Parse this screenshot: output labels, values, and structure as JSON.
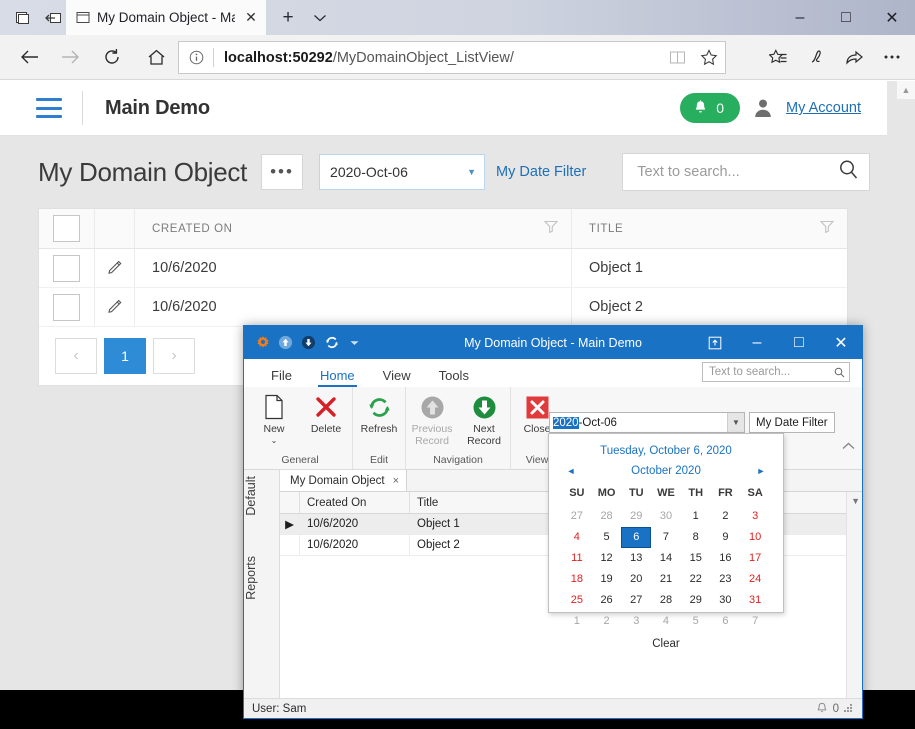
{
  "browser": {
    "tab": {
      "title": "My Domain Object - Ma",
      "close_label": "✕"
    },
    "new_tab_label": "+",
    "tab_menu_label": "⌄",
    "window_controls": {
      "minimize": "–",
      "maximize": "□",
      "close": "✕"
    },
    "address": {
      "protocol_prefix": "localhost:50292",
      "path": "/MyDomainObject_ListView/"
    },
    "nav": {
      "back": "←",
      "forward": "→",
      "refresh": "↻",
      "home": "⌂"
    }
  },
  "webapp": {
    "header": {
      "title": "Main Demo",
      "notification_count": "0",
      "account_link": "My Account"
    },
    "toolbar": {
      "page_title": "My Domain Object",
      "ellipsis_label": "•••",
      "date_value": "2020-Oct-06",
      "date_filter_label": "My Date Filter",
      "search_placeholder": "Text to search..."
    },
    "grid": {
      "columns": [
        "CREATED ON",
        "TITLE"
      ],
      "rows": [
        {
          "created_on": "10/6/2020",
          "title": "Object 1"
        },
        {
          "created_on": "10/6/2020",
          "title": "Object 2"
        }
      ]
    },
    "pager": {
      "prev": "‹",
      "current": "1",
      "next": "›"
    }
  },
  "winform": {
    "title": "My Domain Object - Main Demo",
    "window_controls": {
      "restore_ribbon": "⬒",
      "minimize": "–",
      "maximize": "□",
      "close": "✕"
    },
    "quick_access": [
      "app-gear-icon",
      "up-arrow-icon",
      "down-arrow-icon",
      "refresh-icon",
      "qat-dropdown-icon"
    ],
    "ribbon_tabs": [
      {
        "label": "File",
        "active": false
      },
      {
        "label": "Home",
        "active": true
      },
      {
        "label": "View",
        "active": false
      },
      {
        "label": "Tools",
        "active": false
      }
    ],
    "ribbon_search_placeholder": "Text to search...",
    "ribbon_groups": [
      {
        "name": "General",
        "items": [
          {
            "label": "New",
            "icon": "new-document-icon",
            "disabled": false,
            "has_dropdown": true
          },
          {
            "label": "Delete",
            "icon": "delete-x-icon",
            "disabled": false,
            "has_dropdown": false
          }
        ]
      },
      {
        "name": "Edit",
        "items": [
          {
            "label": "Refresh",
            "icon": "refresh-icon",
            "disabled": false,
            "has_dropdown": false
          }
        ]
      },
      {
        "name": "Navigation",
        "items": [
          {
            "label": "Previous Record",
            "icon": "previous-record-icon",
            "disabled": true,
            "has_dropdown": false
          },
          {
            "label": "Next Record",
            "icon": "next-record-icon",
            "disabled": false,
            "has_dropdown": false
          }
        ]
      },
      {
        "name": "View",
        "items": [
          {
            "label": "Close",
            "icon": "close-x-icon",
            "disabled": false,
            "has_dropdown": false
          }
        ]
      }
    ],
    "date_editor": {
      "selected_part": "2020",
      "rest": "-Oct-06",
      "filter_label": "My Date Filter"
    },
    "calendar": {
      "today_text": "Tuesday, October 6, 2020",
      "month_label": "October 2020",
      "prev_arrow": "◄",
      "next_arrow": "►",
      "dow": [
        "SU",
        "MO",
        "TU",
        "WE",
        "TH",
        "FR",
        "SA"
      ],
      "weeks": [
        [
          {
            "d": "27",
            "t": "off"
          },
          {
            "d": "28",
            "t": "off"
          },
          {
            "d": "29",
            "t": "off"
          },
          {
            "d": "30",
            "t": "off"
          },
          {
            "d": "1",
            "t": "day"
          },
          {
            "d": "2",
            "t": "day"
          },
          {
            "d": "3",
            "t": "we"
          }
        ],
        [
          {
            "d": "4",
            "t": "we"
          },
          {
            "d": "5",
            "t": "day"
          },
          {
            "d": "6",
            "t": "sel"
          },
          {
            "d": "7",
            "t": "day"
          },
          {
            "d": "8",
            "t": "day"
          },
          {
            "d": "9",
            "t": "day"
          },
          {
            "d": "10",
            "t": "we"
          }
        ],
        [
          {
            "d": "11",
            "t": "we"
          },
          {
            "d": "12",
            "t": "day"
          },
          {
            "d": "13",
            "t": "day"
          },
          {
            "d": "14",
            "t": "day"
          },
          {
            "d": "15",
            "t": "day"
          },
          {
            "d": "16",
            "t": "day"
          },
          {
            "d": "17",
            "t": "we"
          }
        ],
        [
          {
            "d": "18",
            "t": "we"
          },
          {
            "d": "19",
            "t": "day"
          },
          {
            "d": "20",
            "t": "day"
          },
          {
            "d": "21",
            "t": "day"
          },
          {
            "d": "22",
            "t": "day"
          },
          {
            "d": "23",
            "t": "day"
          },
          {
            "d": "24",
            "t": "we"
          }
        ],
        [
          {
            "d": "25",
            "t": "we"
          },
          {
            "d": "26",
            "t": "day"
          },
          {
            "d": "27",
            "t": "day"
          },
          {
            "d": "28",
            "t": "day"
          },
          {
            "d": "29",
            "t": "day"
          },
          {
            "d": "30",
            "t": "day"
          },
          {
            "d": "31",
            "t": "we"
          }
        ],
        [
          {
            "d": "1",
            "t": "off"
          },
          {
            "d": "2",
            "t": "off"
          },
          {
            "d": "3",
            "t": "off"
          },
          {
            "d": "4",
            "t": "off"
          },
          {
            "d": "5",
            "t": "off"
          },
          {
            "d": "6",
            "t": "off"
          },
          {
            "d": "7",
            "t": "off"
          }
        ]
      ],
      "clear_label": "Clear"
    },
    "side_tabs": [
      "Default",
      "Reports"
    ],
    "document_tab": {
      "label": "My Domain Object",
      "close": "×"
    },
    "grid": {
      "columns": [
        "Created On",
        "Title"
      ],
      "rows": [
        {
          "created_on": "10/6/2020",
          "title": "Object 1",
          "selected": true
        },
        {
          "created_on": "10/6/2020",
          "title": "Object 2",
          "selected": false
        }
      ]
    },
    "status": {
      "user": "User: Sam",
      "notification_count": "0"
    }
  },
  "colors": {
    "accent_blue": "#1a72c4",
    "web_accent": "#2e8bd6",
    "notif_green": "#27ae5e",
    "weekend_red": "#e02020",
    "link_blue": "#1d6fb8"
  }
}
